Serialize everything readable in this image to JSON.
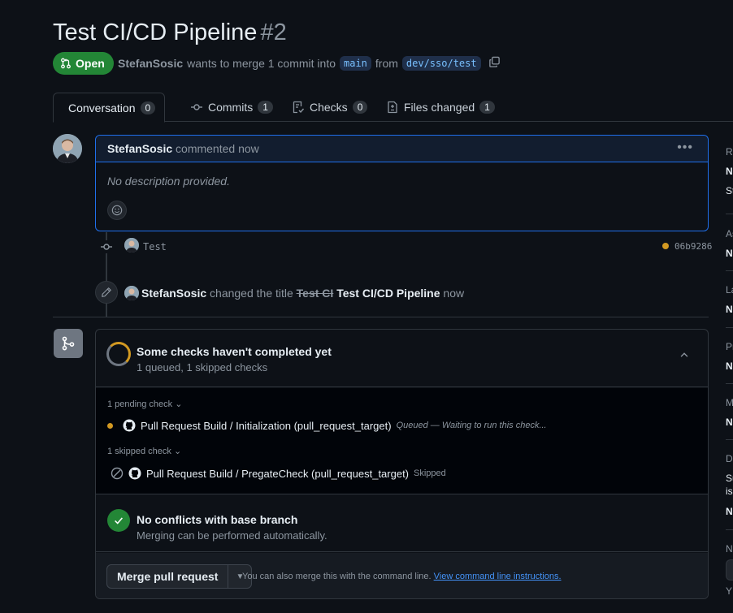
{
  "pr": {
    "title": "Test CI/CD Pipeline",
    "number": "#2",
    "state": "Open",
    "author": "StefanSosic",
    "merge_text": "wants to merge 1 commit into",
    "base_branch": "main",
    "from_text": "from",
    "head_branch": "dev/sso/test"
  },
  "tabs": [
    {
      "label": "Conversation",
      "count": "0"
    },
    {
      "label": "Commits",
      "count": "1"
    },
    {
      "label": "Checks",
      "count": "0"
    },
    {
      "label": "Files changed",
      "count": "1"
    }
  ],
  "comment": {
    "author": "StefanSosic",
    "action": "commented now",
    "body": "No description provided."
  },
  "commit": {
    "message": "Test",
    "sha": "06b9286",
    "status_color": "#d29922"
  },
  "rename_event": {
    "author": "StefanSosic",
    "action": "changed the title",
    "old_title": "Test CI",
    "new_title": "Test CI/CD Pipeline",
    "time": "now"
  },
  "checks": {
    "title": "Some checks haven't completed yet",
    "subtitle": "1 queued, 1 skipped checks",
    "pending_group": "1 pending check",
    "skipped_group": "1 skipped check",
    "pending_check": {
      "name": "Pull Request Build / Initialization (pull_request_target)",
      "status": "Queued — Waiting to run this check..."
    },
    "skipped_check": {
      "name": "Pull Request Build / PregateCheck (pull_request_target)",
      "status": "Skipped"
    }
  },
  "conflicts": {
    "title": "No conflicts with base branch",
    "subtitle": "Merging can be performed automatically."
  },
  "merge": {
    "button": "Merge pull request",
    "hint": "You can also merge this with the command line.",
    "link": "View command line instructions."
  },
  "sidebar_fragments": [
    "Re",
    "N",
    "St",
    "As",
    "N",
    "La",
    "N",
    "Pr",
    "N",
    "M",
    "N",
    "De",
    "Su",
    "is",
    "N",
    "N",
    "Y"
  ],
  "colors": {
    "open_green": "#238636",
    "accent_blue": "#1f6feb",
    "pending_yellow": "#d29922",
    "background": "#0d1117"
  }
}
